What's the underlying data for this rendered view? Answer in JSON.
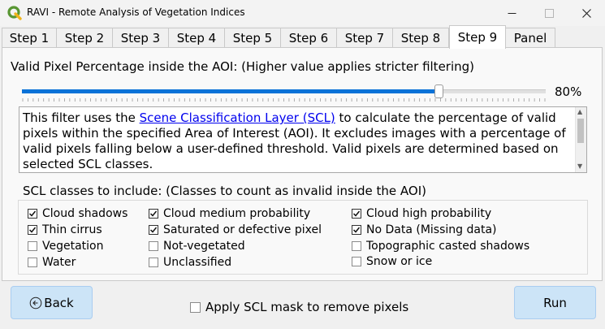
{
  "window": {
    "title": "RAVI - Remote Analysis of Vegetation Indices",
    "app_icon": "qgis-logo-icon"
  },
  "tabs": [
    {
      "label": "Step 1",
      "active": false
    },
    {
      "label": "Step 2",
      "active": false
    },
    {
      "label": "Step 3",
      "active": false
    },
    {
      "label": "Step 4",
      "active": false
    },
    {
      "label": "Step 5",
      "active": false
    },
    {
      "label": "Step 6",
      "active": false
    },
    {
      "label": "Step 7",
      "active": false
    },
    {
      "label": "Step 8",
      "active": false
    },
    {
      "label": "Step 9",
      "active": true
    },
    {
      "label": "Panel",
      "active": false
    }
  ],
  "valid_pixel": {
    "heading": "Valid Pixel Percentage inside the AOI: (Higher value applies stricter filtering)",
    "value": 80,
    "value_label": "80%",
    "accent_color": "#0a72d8"
  },
  "description": {
    "pre_link": "This filter uses the ",
    "link_text": "Scene Classification Layer (SCL)",
    "post_link": " to calculate the percentage of valid pixels within the specified Area of Interest (AOI). It excludes images with a percentage of valid pixels falling below a user-defined threshold. Valid pixels are determined based on selected SCL classes."
  },
  "scl": {
    "heading": "SCL classes to include: (Classes to count as invalid inside the AOI)",
    "columns": [
      [
        {
          "label": "Cloud shadows",
          "checked": true
        },
        {
          "label": "Thin cirrus",
          "checked": true
        },
        {
          "label": "Vegetation",
          "checked": false
        },
        {
          "label": "Water",
          "checked": false
        }
      ],
      [
        {
          "label": "Cloud medium probability",
          "checked": true
        },
        {
          "label": "Saturated or defective pixel",
          "checked": true
        },
        {
          "label": "Not-vegetated",
          "checked": false
        },
        {
          "label": "Unclassified",
          "checked": false
        }
      ],
      [
        {
          "label": "Cloud high probability",
          "checked": true
        },
        {
          "label": "No Data (Missing data)",
          "checked": true
        },
        {
          "label": "Topographic casted shadows",
          "checked": false
        },
        {
          "label": "Snow or ice",
          "checked": false
        }
      ]
    ]
  },
  "footer": {
    "back_label": "Back",
    "back_icon": "circle-left-arrow-icon",
    "mask_label": "Apply SCL mask to remove pixels",
    "mask_checked": false,
    "run_label": "Run"
  }
}
